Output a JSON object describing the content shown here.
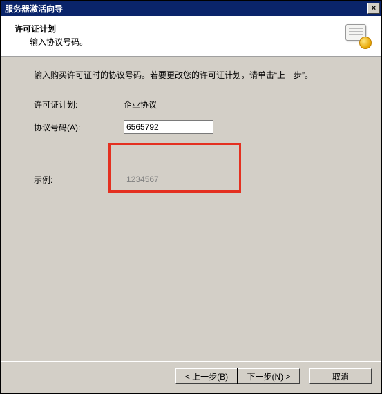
{
  "window": {
    "title": "服务器激活向导",
    "close_glyph": "×"
  },
  "header": {
    "title": "许可证计划",
    "subtitle": "输入协议号码。"
  },
  "content": {
    "instruction": "输入购买许可证时的协议号码。若要更改您的许可证计划，请单击“上一步”。",
    "plan_label": "许可证计划:",
    "plan_value": "企业协议",
    "number_label": "协议号码(A):",
    "number_value": "6565792",
    "example_label": "示例:",
    "example_value": "1234567"
  },
  "footer": {
    "back": "< 上一步(B)",
    "next": "下一步(N) >",
    "cancel": "取消"
  }
}
